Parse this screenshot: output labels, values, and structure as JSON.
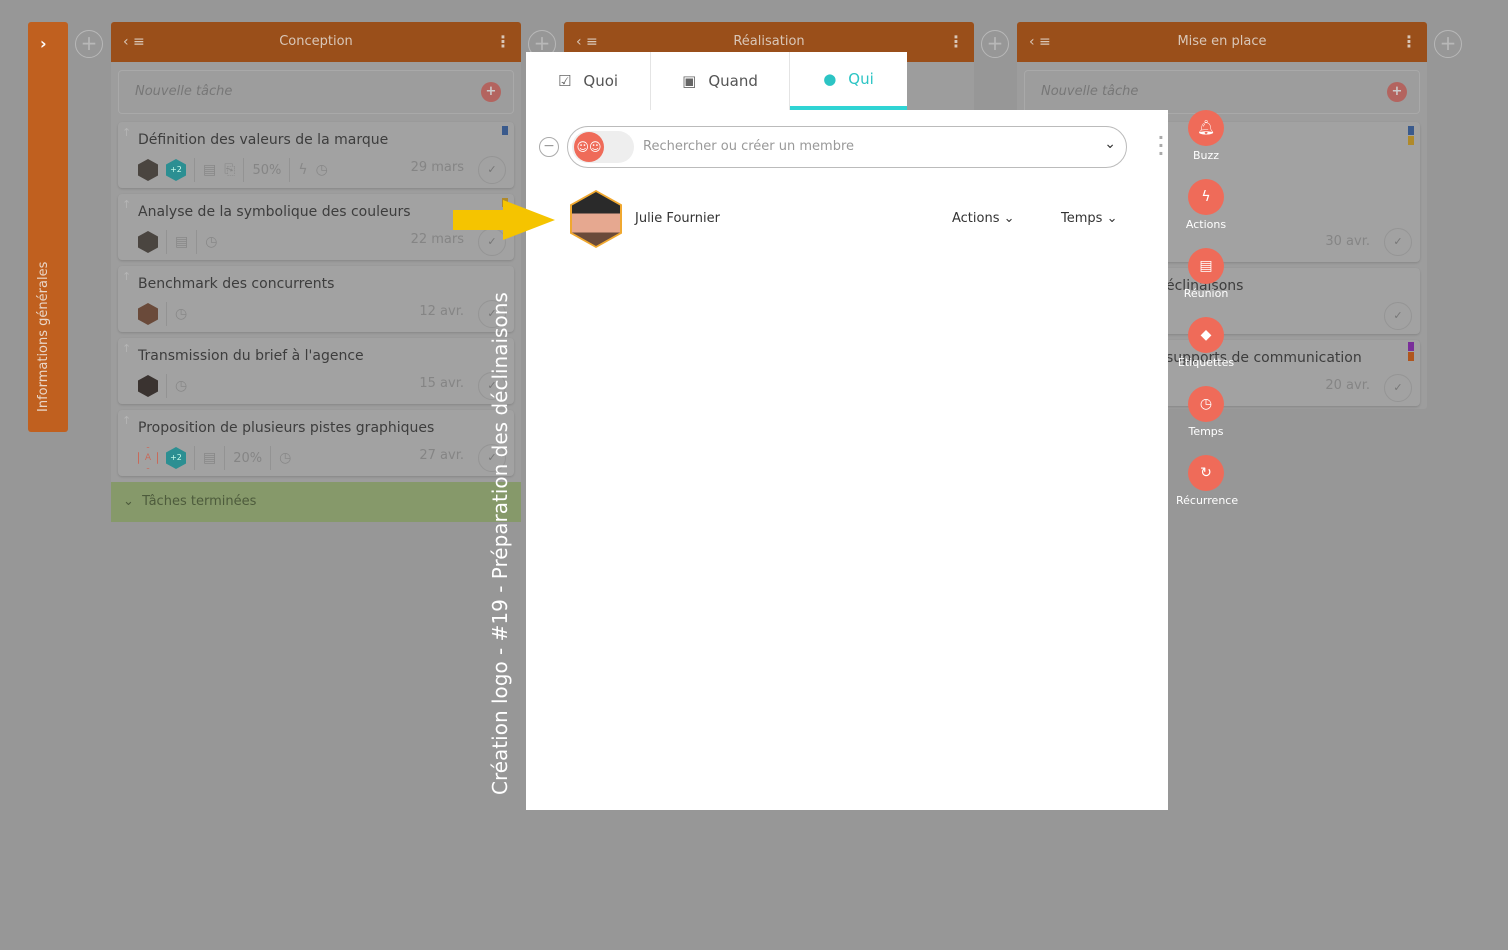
{
  "sidebar": {
    "label": "Informations générales"
  },
  "columns": [
    {
      "title": "Conception",
      "new_task_placeholder": "Nouvelle tâche",
      "cards": [
        {
          "title": "Définition des valeurs de la marque",
          "extra_members": "+2",
          "progress": "50%",
          "date": "29 mars",
          "flags": [
            "#3a5a8c"
          ]
        },
        {
          "title": "Analyse de la symbolique des couleurs",
          "date": "22 mars",
          "flags": [
            "#b08a2a"
          ]
        },
        {
          "title": "Benchmark des concurrents",
          "date": "12 avr."
        },
        {
          "title": "Transmission du brief à l'agence",
          "date": "15 avr."
        },
        {
          "title": "Proposition de plusieurs pistes graphiques",
          "avatar_letter": "A",
          "extra_members": "+2",
          "progress": "20%",
          "date": "27 avr."
        }
      ],
      "done_label": "Tâches terminées"
    },
    {
      "title": "Réalisation"
    },
    {
      "title": "Mise en place",
      "new_task_placeholder": "Nouvelle tâche",
      "cards": [
        {
          "date": "30 avr.",
          "flags": [
            "#3a5a8c",
            "#b08a2a"
          ]
        },
        {
          "title": "éclinaisons"
        },
        {
          "title": "supports de communication",
          "date": "20 avr.",
          "flags": [
            "#7a2f9a",
            "#b0561e"
          ]
        }
      ]
    }
  ],
  "modal": {
    "tabs": [
      {
        "label": "Quoi",
        "icon": "clipboard-check-icon"
      },
      {
        "label": "Quand",
        "icon": "calendar-icon"
      },
      {
        "label": "Qui",
        "icon": "user-circle-icon",
        "active": true
      }
    ],
    "search_placeholder": "Rechercher ou créer un membre",
    "members": [
      {
        "name": "Julie Fournier",
        "actions_label": "Actions",
        "time_label": "Temps"
      }
    ]
  },
  "dragged_task": "Création logo - #19 - Préparation des déclinaisons",
  "quick_actions": [
    {
      "label": "Buzz",
      "icon": "bell-icon"
    },
    {
      "label": "Actions",
      "icon": "bolt-icon"
    },
    {
      "label": "Réunion",
      "icon": "calendar-icon"
    },
    {
      "label": "Étiquettes",
      "icon": "tag-icon"
    },
    {
      "label": "Temps",
      "icon": "clock-icon"
    },
    {
      "label": "Récurrence",
      "icon": "sync-icon"
    }
  ],
  "colors": {
    "accent": "#ef6b59",
    "tab_active": "#2fd4d4",
    "column_header": "#c0601f",
    "arrow": "#f5c400"
  }
}
